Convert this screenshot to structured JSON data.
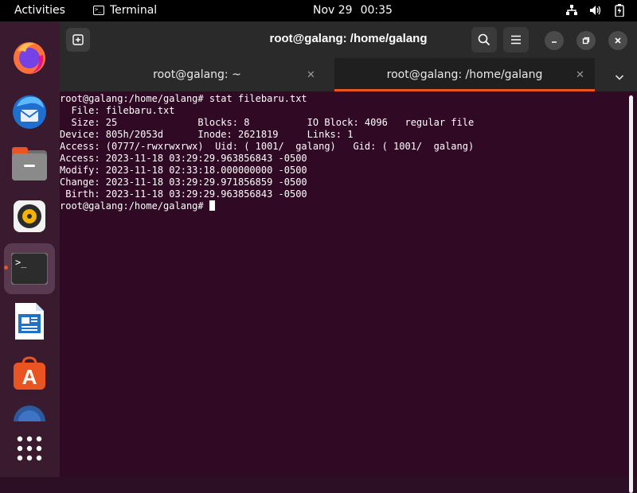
{
  "topbar": {
    "activities": "Activities",
    "app_name": "Terminal",
    "date": "Nov 29",
    "time": "00:35"
  },
  "dock": {
    "items": [
      "firefox",
      "thunderbird",
      "files",
      "rhythmbox",
      "terminal",
      "libreoffice-writer",
      "app-center",
      "help"
    ],
    "show_apps": "show-apps"
  },
  "window": {
    "title": "root@galang: /home/galang",
    "tabs": [
      {
        "label": "root@galang: ~"
      },
      {
        "label": "root@galang: /home/galang"
      }
    ]
  },
  "terminal": {
    "lines": [
      "root@galang:/home/galang# stat filebaru.txt",
      "  File: filebaru.txt",
      "  Size: 25              Blocks: 8          IO Block: 4096   regular file",
      "Device: 805h/2053d      Inode: 2621819     Links: 1",
      "Access: (0777/-rwxrwxrwx)  Uid: ( 1001/  galang)   Gid: ( 1001/  galang)",
      "Access: 2023-11-18 03:29:29.963856843 -0500",
      "Modify: 2023-11-18 02:33:18.000000000 -0500",
      "Change: 2023-11-18 03:29:29.971856859 -0500",
      " Birth: 2023-11-18 03:29:29.963856843 -0500"
    ],
    "prompt": "root@galang:/home/galang# "
  },
  "colors": {
    "accent": "#e95420",
    "terminal_bg": "#300a24",
    "dock_bg": "#3a1a2f",
    "header_bg": "#2a2a2a"
  }
}
